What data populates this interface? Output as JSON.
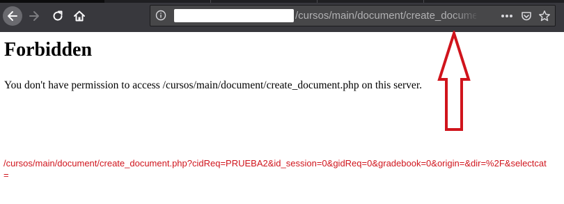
{
  "browser": {
    "url_path": "/cursos/main/document/create_document.",
    "icons": {
      "back": "back-arrow-icon",
      "forward": "forward-arrow-icon",
      "reload": "reload-icon",
      "home": "home-icon",
      "info": "info-icon",
      "more": "more-actions-icon",
      "pocket": "pocket-icon",
      "bookmark": "star-icon"
    }
  },
  "page": {
    "title": "Forbidden",
    "message": "You don't have permission to access /cursos/main/document/create_document.php on this server."
  },
  "annotation": {
    "url": "/cursos/main/document/create_document.php?cidReq=PRUEBA2&id_session=0&gidReq=0&gradebook=0&origin=&dir=%2F&selectcat=",
    "color": "#d0141c"
  },
  "colors": {
    "toolbar": "#38383d",
    "urlbar": "#474749",
    "url_text": "#b1b1b3",
    "arrow": "#d0141c"
  }
}
